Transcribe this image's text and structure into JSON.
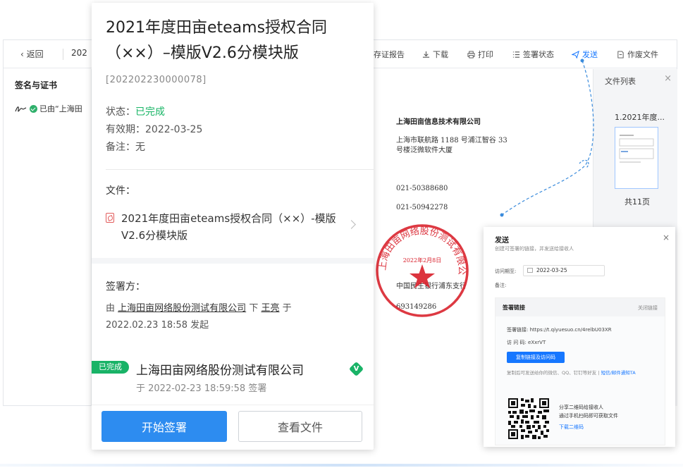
{
  "background_window": {
    "back_label": "返回",
    "title_fragment": "202",
    "toolbar": [
      {
        "label": "存证报告",
        "icon": "report-icon"
      },
      {
        "label": "下载",
        "icon": "download-icon"
      },
      {
        "label": "打印",
        "icon": "print-icon"
      },
      {
        "label": "签署状态",
        "icon": "list-icon"
      },
      {
        "label": "发送",
        "icon": "send-icon",
        "active": true
      },
      {
        "label": "作废文件",
        "icon": "void-file-icon"
      }
    ],
    "left_panel": {
      "title": "签名与证书",
      "item_text": "已由“上海田"
    },
    "document": {
      "company": "上海田亩信息技术有限公司",
      "address_line1": "上海市联航路 1188 号浦江智谷 33",
      "address_line2": "号楼泛微软件大厦",
      "phone1": "021-50388680",
      "phone2": "021-50942278",
      "bank": "中国民生银行浦东支行",
      "account": "693149286"
    },
    "seal": {
      "ring_text": "上海田亩网络股份测试有限公司",
      "date_text": "2022年2月8日"
    },
    "file_panel": {
      "title": "文件列表",
      "file_name": "1.2021年度...",
      "pages": "共11页"
    }
  },
  "mobile": {
    "title": "2021年度田亩eteams授权合同（××）–模版V2.6分模块版",
    "code": "[202202230000078]",
    "status_label": "状态：",
    "status_value": "已完成",
    "validity_label": "有效期：",
    "validity_value": "2022-03-25",
    "remark_label": "备注：",
    "remark_value": "无",
    "file_section_label": "文件：",
    "file_name": "2021年度田亩eteams授权合同（××）-模版V2.6分模块版",
    "signer_section_label": "签署方：",
    "signer_desc_prefix": "由",
    "signer_company_link": "上海田亩网络股份测试有限公司",
    "signer_desc_middle": "下",
    "signer_person": "王亮",
    "signer_desc_suffix": "于",
    "signer_initiated": "2022.02.23 18:58 发起",
    "signer_badge": "已完成",
    "signer_company": "上海田亩网络股份测试有限公司",
    "signer_verified_mark": "V",
    "signer_signed_at": "于 2022-02-23 18:59:58 签署",
    "btn_start_sign": "开始签署",
    "btn_view_file": "查看文件"
  },
  "send_dialog": {
    "title": "发送",
    "subtitle": "创建可签署的链接，并发送给接收人",
    "deadline_label": "访问期至:",
    "deadline_value": "2022-03-25",
    "remark_label": "备注:",
    "box_title": "签署链接",
    "box_close": "关闭链接",
    "link_label": "签署链接:",
    "link_value": "https://t.qiyuesuo.cn/4relbU03XR",
    "code_label": "访 问 码:",
    "code_value": "eXxrVT",
    "copy_button": "复制链接及访问码",
    "hint_text": "复制后可发送给你的微信、QQ、钉钉等好友",
    "hint_divider": "|",
    "hint_link": "短信/邮件通知TA",
    "share_line1": "分享二维码给接收人",
    "share_line2": "通过手机扫码即可获取文件",
    "download_qr": "下载二维码"
  },
  "colors": {
    "primary": "#2d8cf0",
    "success": "#19b367",
    "seal_red": "#d9232e",
    "link_blue": "#1677ff"
  }
}
